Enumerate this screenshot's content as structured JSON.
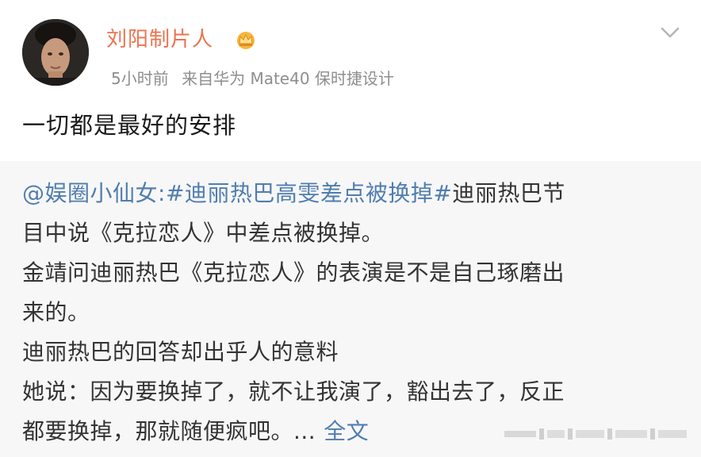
{
  "post": {
    "author": "刘阳制片人",
    "time": "5小时前",
    "source": "来自华为 Mate40 保时捷设计",
    "text": "一切都是最好的安排"
  },
  "repost": {
    "mention": "@娱圈小仙女:",
    "hashtag": "#迪丽热巴高雯差点被换掉#",
    "line1_rest": "迪丽热巴节",
    "line2": "目中说《克拉恋人》中差点被换掉。",
    "line3": "金靖问迪丽热巴《克拉恋人》的表演是不是自己琢磨出",
    "line4": "来的。",
    "line5": "迪丽热巴的回答却出乎人的意料",
    "line6": "她说：因为要换掉了，就不让我演了，豁出去了，反正",
    "line7": "都要换掉，那就随便疯吧。...",
    "more_label": "全文"
  },
  "icons": {
    "crown": "crown-icon",
    "chevron": "chevron-down-icon"
  },
  "colors": {
    "author": "#eb7350",
    "link": "#507daf",
    "meta": "#8e8e8e",
    "repost_bg": "#f7f7f7"
  }
}
